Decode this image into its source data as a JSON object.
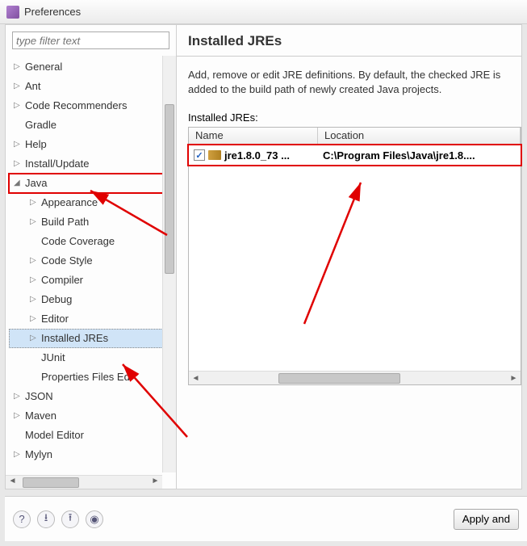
{
  "window": {
    "title": "Preferences"
  },
  "filter": {
    "placeholder": "type filter text"
  },
  "tree": [
    {
      "label": "General",
      "expandable": true
    },
    {
      "label": "Ant",
      "expandable": true
    },
    {
      "label": "Code Recommenders",
      "expandable": true
    },
    {
      "label": "Gradle",
      "expandable": false
    },
    {
      "label": "Help",
      "expandable": true
    },
    {
      "label": "Install/Update",
      "expandable": true
    },
    {
      "label": "Java",
      "expandable": true,
      "expanded": true,
      "highlight": true,
      "children": [
        {
          "label": "Appearance",
          "expandable": true
        },
        {
          "label": "Build Path",
          "expandable": true
        },
        {
          "label": "Code Coverage",
          "expandable": false
        },
        {
          "label": "Code Style",
          "expandable": true
        },
        {
          "label": "Compiler",
          "expandable": true
        },
        {
          "label": "Debug",
          "expandable": true
        },
        {
          "label": "Editor",
          "expandable": true
        },
        {
          "label": "Installed JREs",
          "expandable": true,
          "selected": true,
          "highlight": true
        },
        {
          "label": "JUnit",
          "expandable": false
        },
        {
          "label": "Properties Files Edi",
          "expandable": false
        }
      ]
    },
    {
      "label": "JSON",
      "expandable": true
    },
    {
      "label": "Maven",
      "expandable": true
    },
    {
      "label": "Model Editor",
      "expandable": false
    },
    {
      "label": "Mylyn",
      "expandable": true
    }
  ],
  "page": {
    "heading": "Installed JREs",
    "description": "Add, remove or edit JRE definitions. By default, the checked JRE is added to the build path of newly created Java projects.",
    "subheading": "Installed JREs:",
    "columns": {
      "name": "Name",
      "location": "Location"
    },
    "rows": [
      {
        "checked": true,
        "name": "jre1.8.0_73 ...",
        "location": "C:\\Program Files\\Java\\jre1.8...."
      }
    ]
  },
  "buttons": {
    "apply": "Apply and"
  }
}
